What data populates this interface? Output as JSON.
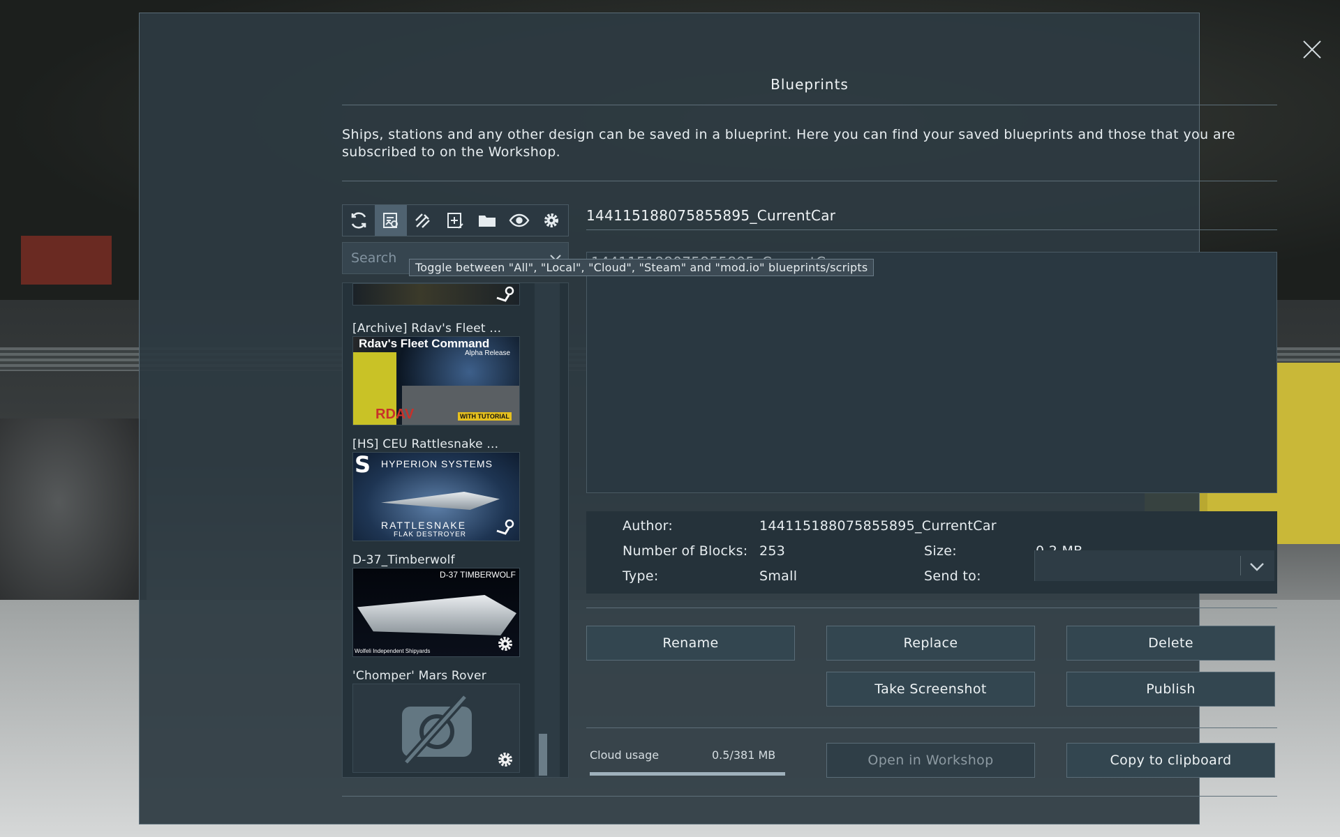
{
  "dialog": {
    "title": "Blueprints",
    "description": "Ships, stations and any other design can be saved in a blueprint. Here you can find your saved blueprints and those that you are subscribed to on the Workshop."
  },
  "toolbar": {
    "icons": [
      "refresh-icon",
      "blueprint-filter-icon",
      "edit-brush-icon",
      "new-blueprint-icon",
      "folder-icon",
      "eye-icon",
      "gear-icon"
    ]
  },
  "search": {
    "placeholder": "Search"
  },
  "tooltip": {
    "text": "Toggle between \"All\", \"Local\", \"Cloud\", \"Steam\" and \"mod.io\" blueprints/scripts"
  },
  "list": {
    "items": [
      {
        "name": "[Archive] Rdav's Fleet ...",
        "thumb_title": "Rdav's Fleet Command",
        "thumb_sub": "Alpha Release",
        "thumb_tag": "RDAV",
        "thumb_tag2": "WITH TUTORIAL",
        "source": "steam"
      },
      {
        "name": "[HS] CEU Rattlesnake ...",
        "thumb_title": "HYPERION SYSTEMS",
        "thumb_sub": "RATTLESNAKE",
        "thumb_tag": "FLAK DESTROYER",
        "source": "steam"
      },
      {
        "name": "D-37_Timberwolf",
        "thumb_title": "D-37 TIMBERWOLF",
        "thumb_sub": "Wolfeli Independent Shipyards",
        "source": "local"
      },
      {
        "name": "'Chomper' Mars Rover",
        "source": "local"
      }
    ]
  },
  "selected": {
    "name": "144115188075855895_CurrentCar",
    "description_ghost": "144115188075855895_CurrentCar"
  },
  "info": {
    "author_label": "Author:",
    "author_value": "144115188075855895_CurrentCar",
    "blocks_label": "Number of Blocks:",
    "blocks_value": "253",
    "size_label": "Size:",
    "size_value": "0.2 MB",
    "type_label": "Type:",
    "type_value": "Small",
    "sendto_label": "Send to:"
  },
  "buttons": {
    "rename": "Rename",
    "replace": "Replace",
    "delete": "Delete",
    "screenshot": "Take Screenshot",
    "publish": "Publish",
    "open_workshop": "Open in Workshop",
    "copy": "Copy to clipboard"
  },
  "cloud": {
    "label": "Cloud usage",
    "value": "0.5/381 MB",
    "fraction": 0.0013
  },
  "colors": {
    "panel": "#2d3a42",
    "accent": "#4f6270",
    "text": "#e6ecef"
  }
}
